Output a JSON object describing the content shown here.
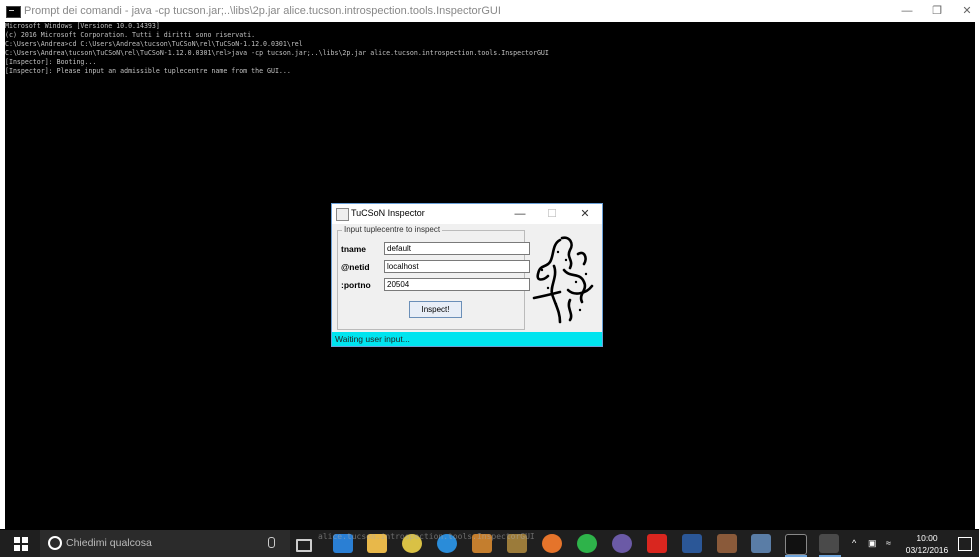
{
  "console": {
    "title": "Prompt dei comandi - java  -cp tucson.jar;..\\libs\\2p.jar alice.tucson.introspection.tools.InspectorGUI",
    "lines": [
      "Microsoft Windows [Versione 10.0.14393]",
      "(c) 2016 Microsoft Corporation. Tutti i diritti sono riservati.",
      "",
      "C:\\Users\\Andrea>cd C:\\Users\\Andrea\\tucson\\TuCSoN\\rel\\TuCSoN-1.12.0.0301\\rel",
      "",
      "C:\\Users\\Andrea\\tucson\\TuCSoN\\rel\\TuCSoN-1.12.0.0301\\rel>java -cp tucson.jar;..\\libs\\2p.jar alice.tucson.introspection.tools.InspectorGUI",
      "[Inspector]: Booting...",
      "[Inspector]: Please input an admissible tuplecentre name from the GUI..."
    ]
  },
  "dialog": {
    "title": "TuCSoN Inspector",
    "group_title": "Input tuplecentre to inspect",
    "fields": {
      "tname_label": "tname",
      "tname_value": "default",
      "netid_label": "@netid",
      "netid_value": "localhost",
      "portno_label": ":portno",
      "portno_value": "20504"
    },
    "inspect_label": "Inspect!",
    "status": "Waiting user input...",
    "status_color": "#00e4ef"
  },
  "taskbar": {
    "search_placeholder": "Chiedimi qualcosa",
    "ghost_text": "alice.tucson.introspection.tools.InspectorGUI",
    "clock_time": "10:00",
    "clock_date": "03/12/2016",
    "accent": "#6ea3d9"
  }
}
